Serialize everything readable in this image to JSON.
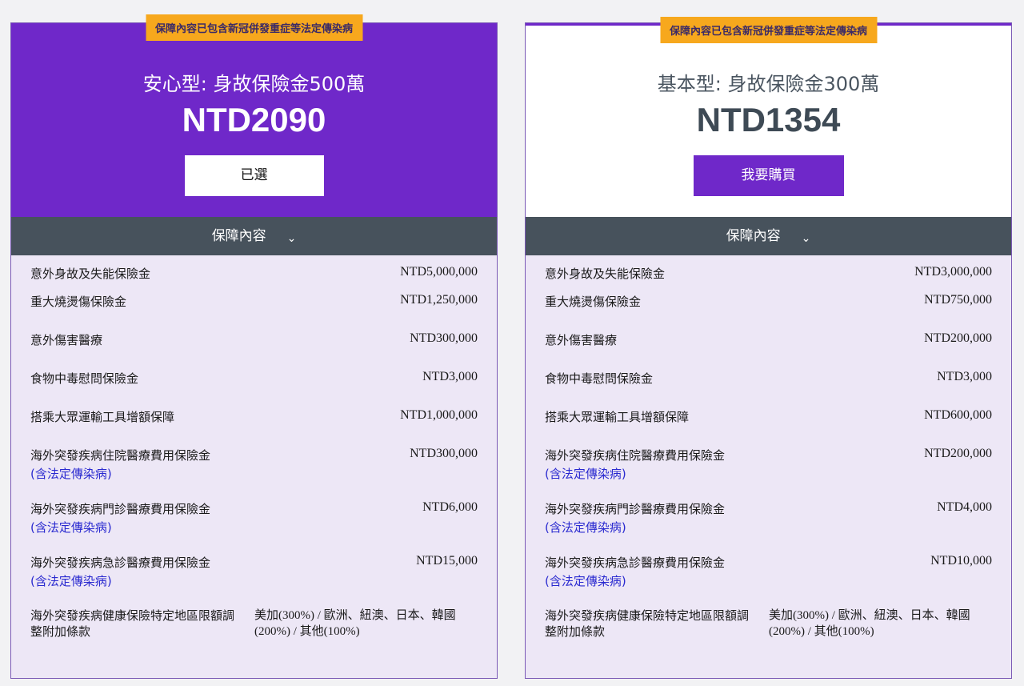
{
  "banner": "保障內容已包含新冠併發重症等法定傳染病",
  "coverage_label": "保障內容",
  "cards": [
    {
      "title": "安心型: 身故保險金500萬",
      "price": "NTD2090",
      "cta": "已選",
      "values": [
        "NTD5,000,000",
        "NTD1,250,000",
        "NTD300,000",
        "NTD3,000",
        "NTD1,000,000",
        "NTD300,000",
        "NTD6,000",
        "NTD15,000"
      ]
    },
    {
      "title": "基本型: 身故保險金300萬",
      "price": "NTD1354",
      "cta": "我要購買",
      "values": [
        "NTD3,000,000",
        "NTD750,000",
        "NTD200,000",
        "NTD3,000",
        "NTD600,000",
        "NTD200,000",
        "NTD4,000",
        "NTD10,000"
      ]
    }
  ],
  "rows": {
    "labels": [
      "意外身故及失能保險金",
      "重大燒燙傷保險金",
      "意外傷害醫療",
      "食物中毒慰問保險金",
      "搭乘大眾運輸工具增額保障",
      "海外突發疾病住院醫療費用保險金",
      "海外突發疾病門診醫療費用保險金",
      "海外突發疾病急診醫療費用保險金"
    ],
    "note": "(含法定傳染病)",
    "last_label_line1": "海外突發疾病健康保險特定地區限額調",
    "last_label_line2": "整附加條款",
    "last_value_line1": "美加(300%) / 歐洲、紐澳、日本、韓國",
    "last_value_line2": "(200%) / 其他(100%)"
  },
  "colors": {
    "purple": "#6f28c9",
    "banner": "#f7a81d",
    "header": "#47525c",
    "list_bg": "#ede7f6"
  },
  "icons": {
    "chevron": "chevron-down-icon"
  }
}
